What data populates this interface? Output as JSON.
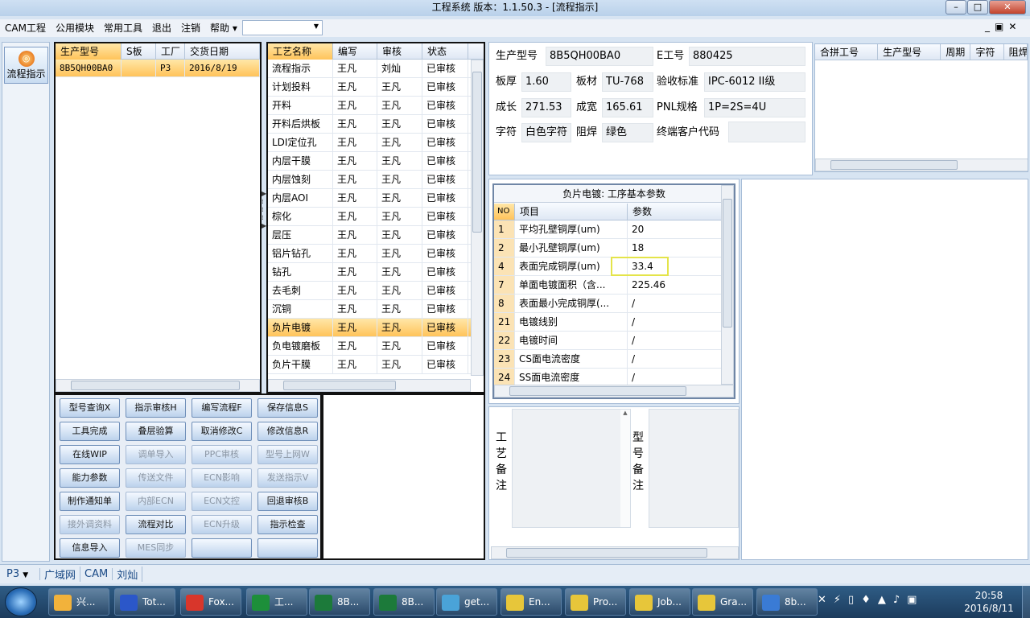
{
  "window": {
    "title": "工程系统   版本：1.1.50.3 - [流程指示]",
    "min": "–",
    "max": "□",
    "close": "✕"
  },
  "menu": [
    "CAM工程",
    "公用模块",
    "常用工具",
    "退出",
    "注销",
    "帮助"
  ],
  "menu_help_arrow": "▾",
  "mdi_controls": [
    "_",
    "▣",
    "✕"
  ],
  "nav": {
    "button": "流程指示",
    "orb": "◎"
  },
  "model_grid": {
    "headers": [
      "生产型号",
      "S板",
      "工厂",
      "交货日期"
    ],
    "rows": [
      [
        "8B5QH00BA0",
        "",
        "P3",
        "2016/8/19"
      ]
    ]
  },
  "process_grid": {
    "headers": [
      "工艺名称",
      "编写",
      "审核",
      "状态"
    ],
    "rows": [
      [
        "流程指示",
        "王凡",
        "刘灿",
        "已审核"
      ],
      [
        "计划投料",
        "王凡",
        "王凡",
        "已审核"
      ],
      [
        "开料",
        "王凡",
        "王凡",
        "已审核"
      ],
      [
        "开料后烘板",
        "王凡",
        "王凡",
        "已审核"
      ],
      [
        "LDI定位孔",
        "王凡",
        "王凡",
        "已审核"
      ],
      [
        "内层干膜",
        "王凡",
        "王凡",
        "已审核"
      ],
      [
        "内层蚀刻",
        "王凡",
        "王凡",
        "已审核"
      ],
      [
        "内层AOI",
        "王凡",
        "王凡",
        "已审核"
      ],
      [
        "棕化",
        "王凡",
        "王凡",
        "已审核"
      ],
      [
        "层压",
        "王凡",
        "王凡",
        "已审核"
      ],
      [
        "铝片钻孔",
        "王凡",
        "王凡",
        "已审核"
      ],
      [
        "钻孔",
        "王凡",
        "王凡",
        "已审核"
      ],
      [
        "去毛刺",
        "王凡",
        "王凡",
        "已审核"
      ],
      [
        "沉铜",
        "王凡",
        "王凡",
        "已审核"
      ],
      [
        "负片电镀",
        "王凡",
        "王凡",
        "已审核"
      ],
      [
        "负电镀磨板",
        "王凡",
        "王凡",
        "已审核"
      ],
      [
        "负片干膜",
        "王凡",
        "王凡",
        "已审核"
      ]
    ],
    "selected": 14
  },
  "buttons": [
    {
      "label": "型号查询X",
      "enabled": true
    },
    {
      "label": "指示审核H",
      "enabled": true
    },
    {
      "label": "编写流程F",
      "enabled": true
    },
    {
      "label": "保存信息S",
      "enabled": true
    },
    {
      "label": "工具完成",
      "enabled": true
    },
    {
      "label": "叠层验算",
      "enabled": true
    },
    {
      "label": "取消修改C",
      "enabled": true
    },
    {
      "label": "修改信息R",
      "enabled": true
    },
    {
      "label": "在线WIP",
      "enabled": true
    },
    {
      "label": "调单导入",
      "enabled": false
    },
    {
      "label": "PPC审核",
      "enabled": false
    },
    {
      "label": "型号上网W",
      "enabled": false
    },
    {
      "label": "能力参数",
      "enabled": true
    },
    {
      "label": "传送文件",
      "enabled": false
    },
    {
      "label": "ECN影响",
      "enabled": false
    },
    {
      "label": "发送指示V",
      "enabled": false
    },
    {
      "label": "制作通知单",
      "enabled": true
    },
    {
      "label": "内部ECN",
      "enabled": false
    },
    {
      "label": "ECN文控",
      "enabled": false
    },
    {
      "label": "回退审核B",
      "enabled": true
    },
    {
      "label": "接外调资料",
      "enabled": false
    },
    {
      "label": "流程对比",
      "enabled": true
    },
    {
      "label": "ECN升级",
      "enabled": false
    },
    {
      "label": "指示检查",
      "enabled": true
    },
    {
      "label": "信息导入",
      "enabled": true
    },
    {
      "label": "MES同步",
      "enabled": false
    },
    {
      "label": "",
      "enabled": true
    },
    {
      "label": "",
      "enabled": true
    }
  ],
  "info": {
    "prod_model_label": "生产型号",
    "prod_model": "8B5QH00BA0",
    "e_label": "E工号",
    "e_no": "880425",
    "thick_label": "板厚",
    "thick": "1.60",
    "material_label": "板材",
    "material": "TU-768",
    "std_label": "验收标准",
    "std": "IPC-6012 II级",
    "len_label": "成长",
    "len": "271.53",
    "width_label": "成宽",
    "width": "165.61",
    "pnl_label": "PNL规格",
    "pnl": "1P=2S=4U",
    "char_label": "字符",
    "char": "白色字符",
    "mask_label": "阻焊",
    "mask": "绿色",
    "cust_label": "终端客户代码",
    "cust": ""
  },
  "merge_grid": {
    "headers": [
      "合拼工号",
      "生产型号",
      "周期",
      "字符",
      "阻焊"
    ]
  },
  "param_grid": {
    "title": "负片电镀: 工序基本参数",
    "headers": [
      "NO",
      "项目",
      "参数"
    ],
    "rows": [
      [
        "1",
        "平均孔壁铜厚(um)",
        "20"
      ],
      [
        "2",
        "最小孔壁铜厚(um)",
        "18"
      ],
      [
        "4",
        "表面完成铜厚(um)",
        "33.4"
      ],
      [
        "7",
        "单面电镀面积（含...",
        "225.46"
      ],
      [
        "8",
        "表面最小完成铜厚(...",
        "/"
      ],
      [
        "21",
        "电镀线别",
        "/"
      ],
      [
        "22",
        "电镀时间",
        "/"
      ],
      [
        "23",
        "CS面电流密度",
        "/"
      ],
      [
        "24",
        "SS面电流密度",
        "/"
      ]
    ],
    "highlight": 2
  },
  "notes": {
    "process": "工艺备注",
    "model": "型号备注"
  },
  "status": {
    "plant": "P3",
    "net": "广域网",
    "dept": "CAM",
    "user": "刘灿"
  },
  "taskbar": {
    "items": [
      "兴...",
      "Tot...",
      "Fox...",
      "工...",
      "8B...",
      "8B...",
      "get...",
      "En...",
      "Pro...",
      "Job...",
      "Gra...",
      "8b..."
    ],
    "time": "20:58",
    "date": "2016/8/11"
  }
}
